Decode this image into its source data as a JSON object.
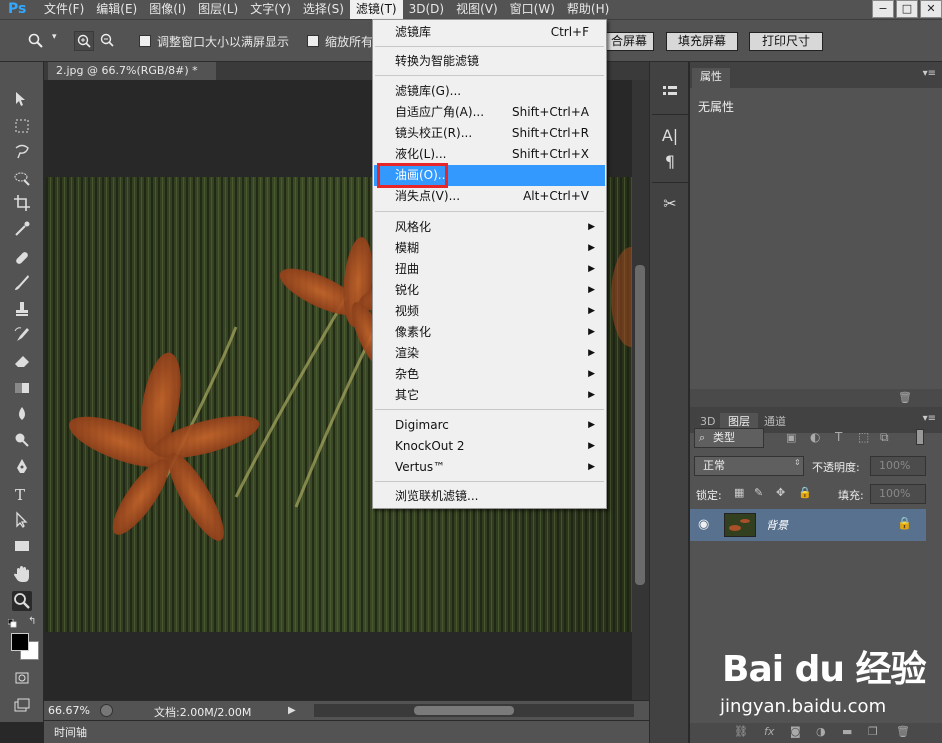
{
  "app": {
    "logo": "Ps"
  },
  "menubar": {
    "items": [
      "文件(F)",
      "编辑(E)",
      "图像(I)",
      "图层(L)",
      "文字(Y)",
      "选择(S)",
      "滤镜(T)",
      "3D(D)",
      "视图(V)",
      "窗口(W)",
      "帮助(H)"
    ],
    "active": "滤镜(T)"
  },
  "window_controls": {
    "minimize": "−",
    "maximize": "□",
    "close": "✕"
  },
  "options": {
    "chk1_label": "调整窗口大小以满屏显示",
    "chk2_label": "缩放所有",
    "fit_label": "合屏幕",
    "fill_label": "填充屏幕",
    "print_label": "打印尺寸"
  },
  "document": {
    "tab_title": "2.jpg @ 66.7%(RGB/8#) *",
    "zoom": "66.67%",
    "doc_info": "文档:2.00M/2.00M"
  },
  "timeline": {
    "label": "时间轴"
  },
  "filter_menu": {
    "items": [
      {
        "label": "滤镜库",
        "shortcut": "Ctrl+F"
      },
      {
        "label": "转换为智能滤镜",
        "shortcut": ""
      },
      {
        "label": "滤镜库(G)...",
        "shortcut": ""
      },
      {
        "label": "自适应广角(A)...",
        "shortcut": "Shift+Ctrl+A"
      },
      {
        "label": "镜头校正(R)...",
        "shortcut": "Shift+Ctrl+R"
      },
      {
        "label": "液化(L)...",
        "shortcut": "Shift+Ctrl+X"
      },
      {
        "label": "油画(O)...",
        "shortcut": ""
      },
      {
        "label": "消失点(V)...",
        "shortcut": "Alt+Ctrl+V"
      }
    ],
    "submenus": [
      "风格化",
      "模糊",
      "扭曲",
      "锐化",
      "视频",
      "像素化",
      "渲染",
      "杂色",
      "其它"
    ],
    "plugins": [
      "Digimarc",
      "KnockOut 2",
      "Vertus™"
    ],
    "browse": "浏览联机滤镜..."
  },
  "properties_panel": {
    "tab": "属性",
    "empty_text": "无属性"
  },
  "layers_panel": {
    "tabs": [
      "3D",
      "图层",
      "通道"
    ],
    "active_tab": "图层",
    "filter_kind": "类型",
    "blend_mode": "正常",
    "opacity_label": "不透明度:",
    "opacity_value": "100%",
    "lock_label": "锁定:",
    "fill_label": "填充:",
    "fill_value": "100%",
    "layers": [
      {
        "name": "背景",
        "locked": true,
        "visible": true
      }
    ]
  },
  "watermark": {
    "logo": "Bai du 经验",
    "url": "jingyan.baidu.com"
  },
  "colors": {
    "menu_highlight": "#3399ff",
    "callout_red": "#e8262a",
    "layer_selected": "#57718f"
  }
}
